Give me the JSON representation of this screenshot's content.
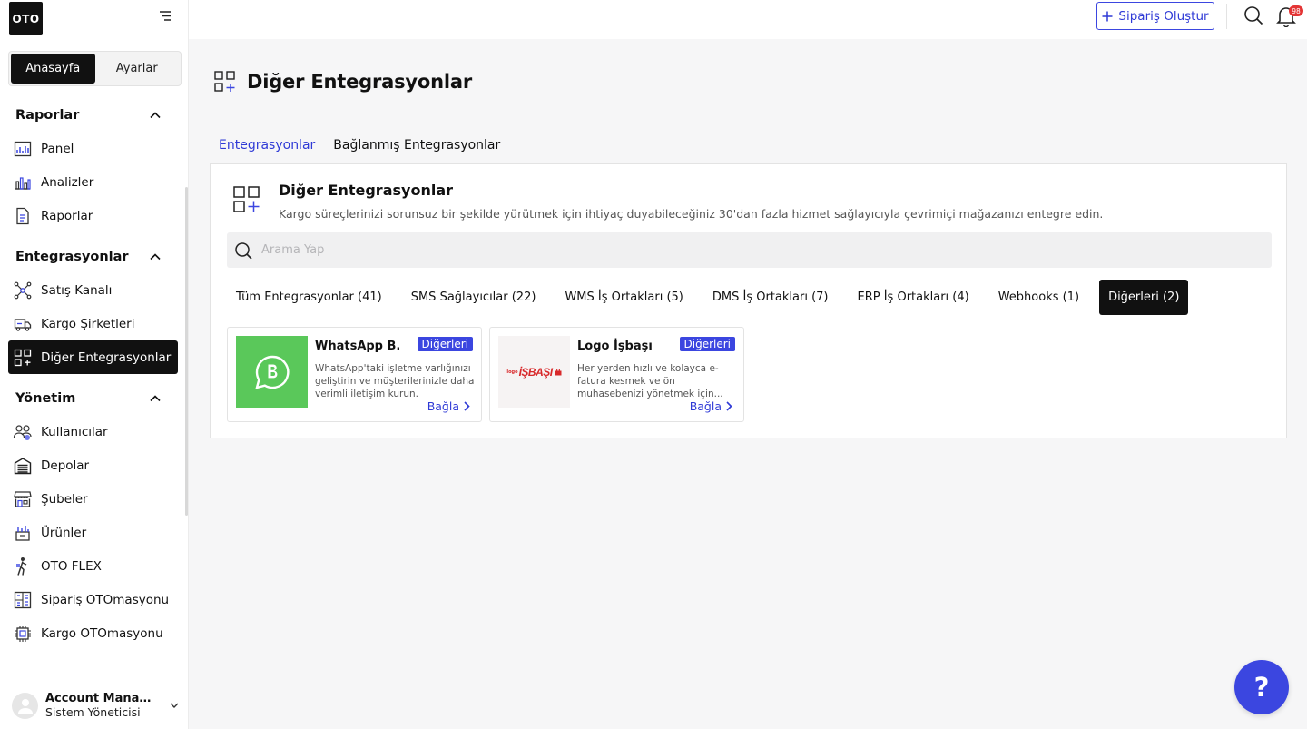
{
  "app": {
    "logo_text": "OTO"
  },
  "sidebar": {
    "segments": [
      {
        "label": "Anasayfa",
        "active": true
      },
      {
        "label": "Ayarlar",
        "active": false
      }
    ],
    "sections": [
      {
        "title": "Raporlar",
        "items": [
          {
            "label": "Panel",
            "icon": "dashboard-icon"
          },
          {
            "label": "Analizler",
            "icon": "analytics-icon"
          },
          {
            "label": "Raporlar",
            "icon": "report-icon"
          }
        ]
      },
      {
        "title": "Entegrasyonlar",
        "items": [
          {
            "label": "Satış Kanalı",
            "icon": "network-icon"
          },
          {
            "label": "Kargo Şirketleri",
            "icon": "truck-icon"
          },
          {
            "label": "Diğer Entegrasyonlar",
            "icon": "grid-plus-icon",
            "active": true
          }
        ]
      },
      {
        "title": "Yönetim",
        "items": [
          {
            "label": "Kullanıcılar",
            "icon": "users-icon"
          },
          {
            "label": "Depolar",
            "icon": "warehouse-icon"
          },
          {
            "label": "Şubeler",
            "icon": "store-icon"
          },
          {
            "label": "Ürünler",
            "icon": "products-icon"
          },
          {
            "label": "OTO FLEX",
            "icon": "courier-icon"
          },
          {
            "label": "Sipariş OTOmasyonu",
            "icon": "order-automation-icon"
          },
          {
            "label": "Kargo OTOmasyonu",
            "icon": "chip-icon"
          }
        ]
      }
    ],
    "account": {
      "name": "Account Manage...",
      "role": "Sistem Yöneticisi"
    }
  },
  "header": {
    "create_label": "Sipariş Oluştur",
    "notification_count": "98"
  },
  "page": {
    "title": "Diğer Entegrasyonlar",
    "tabs": [
      {
        "label": "Entegrasyonlar",
        "active": true
      },
      {
        "label": "Bağlanmış Entegrasyonlar",
        "active": false
      }
    ],
    "panel": {
      "title": "Diğer Entegrasyonlar",
      "description": "Kargo süreçlerinizi sorunsuz bir şekilde yürütmek için ihtiyaç duyabileceğiniz 30'dan fazla hizmet sağlayıcıyla çevrimiçi mağazanızı entegre edin.",
      "search_placeholder": "Arama Yap",
      "filters": [
        {
          "label": "Tüm Entegrasyonlar (41)",
          "active": false
        },
        {
          "label": "SMS Sağlayıcılar (22)",
          "active": false
        },
        {
          "label": "WMS İş Ortakları (5)",
          "active": false
        },
        {
          "label": "DMS İş Ortakları (7)",
          "active": false
        },
        {
          "label": "ERP İş Ortakları (4)",
          "active": false
        },
        {
          "label": "Webhooks (1)",
          "active": false
        },
        {
          "label": "Diğerleri (2)",
          "active": true
        }
      ],
      "cards": [
        {
          "name": "WhatsApp B.",
          "badge": "Diğerleri",
          "description": "WhatsApp'taki işletme varlığınızı geliştirin ve müşterilerinizle daha verimli iletişim kurun.",
          "link": "Bağla",
          "logo": "whatsapp-business-logo"
        },
        {
          "name": "Logo İşbaşı",
          "badge": "Diğerleri",
          "description": "Her yerden hızlı ve kolayca e-fatura kesmek ve ön muhasebenizi yönetmek için...",
          "link": "Bağla",
          "logo": "logo-isbasi-logo",
          "logo_small": "logo",
          "logo_text": "İŞBAŞI"
        }
      ]
    }
  },
  "help": {
    "label": "?"
  },
  "colors": {
    "accent": "#3b46e0",
    "whatsapp": "#5ac85a",
    "isbasi_red": "#d8282a",
    "dark": "#111111"
  }
}
